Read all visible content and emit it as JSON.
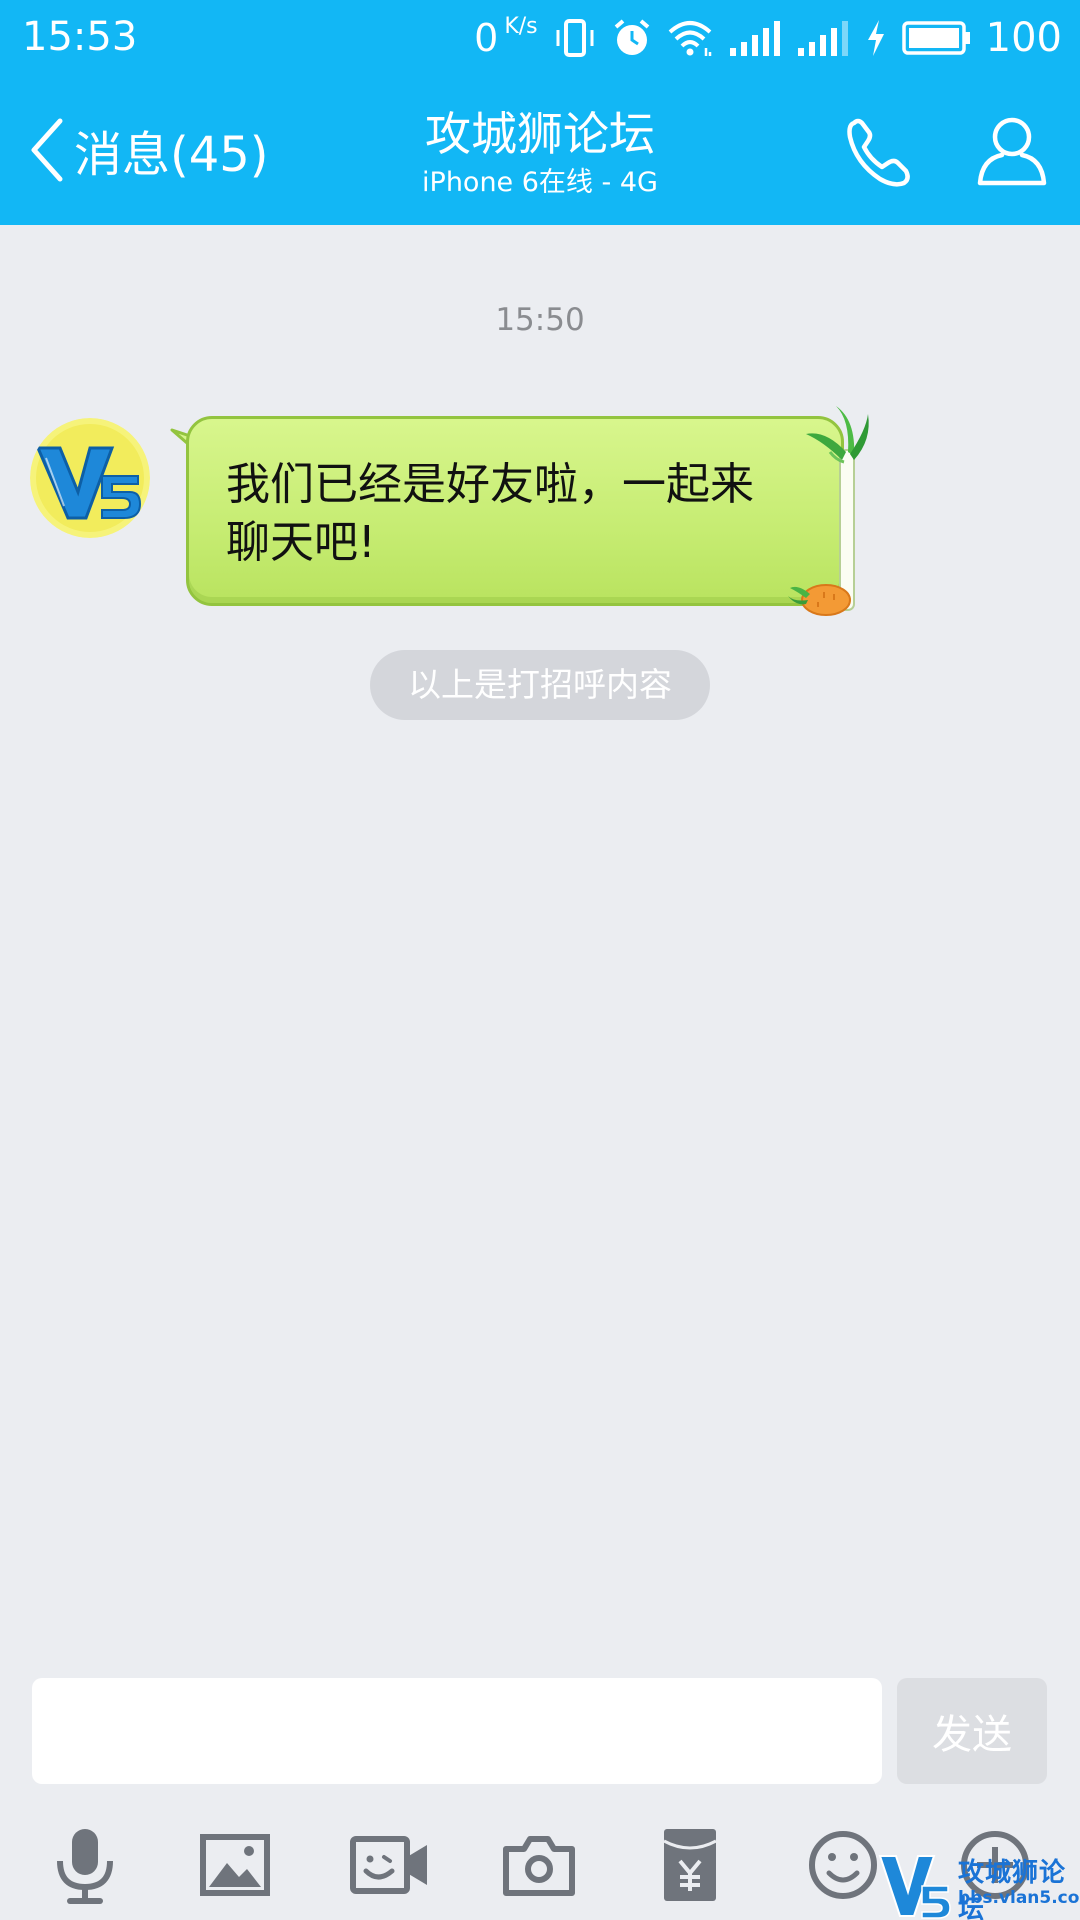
{
  "status_bar": {
    "time": "15:53",
    "net_speed": "0",
    "net_speed_unit": "K/s",
    "battery": "100"
  },
  "header": {
    "back_label": "消息(45)",
    "title": "攻城狮论坛",
    "subtitle": "iPhone 6在线 - 4G"
  },
  "chat": {
    "timestamp": "15:50",
    "messages": [
      {
        "text": "我们已经是好友啦，一起来聊天吧!"
      }
    ],
    "greeting_notice": "以上是打招呼内容"
  },
  "composer": {
    "input_value": "",
    "send_label": "发送"
  },
  "toolbar": {
    "icons": [
      "microphone-icon",
      "image-icon",
      "video-call-icon",
      "camera-icon",
      "red-packet-icon",
      "emoji-icon",
      "plus-icon"
    ]
  },
  "watermark": {
    "logo_text": "V5",
    "title": "攻城狮论坛",
    "url": "bbs.vlan5.com"
  },
  "colors": {
    "header_bg": "#12b7f5",
    "chat_bg": "#ebedf1",
    "bubble_green": "#c6ec72",
    "icon_gray": "#6f747c"
  }
}
